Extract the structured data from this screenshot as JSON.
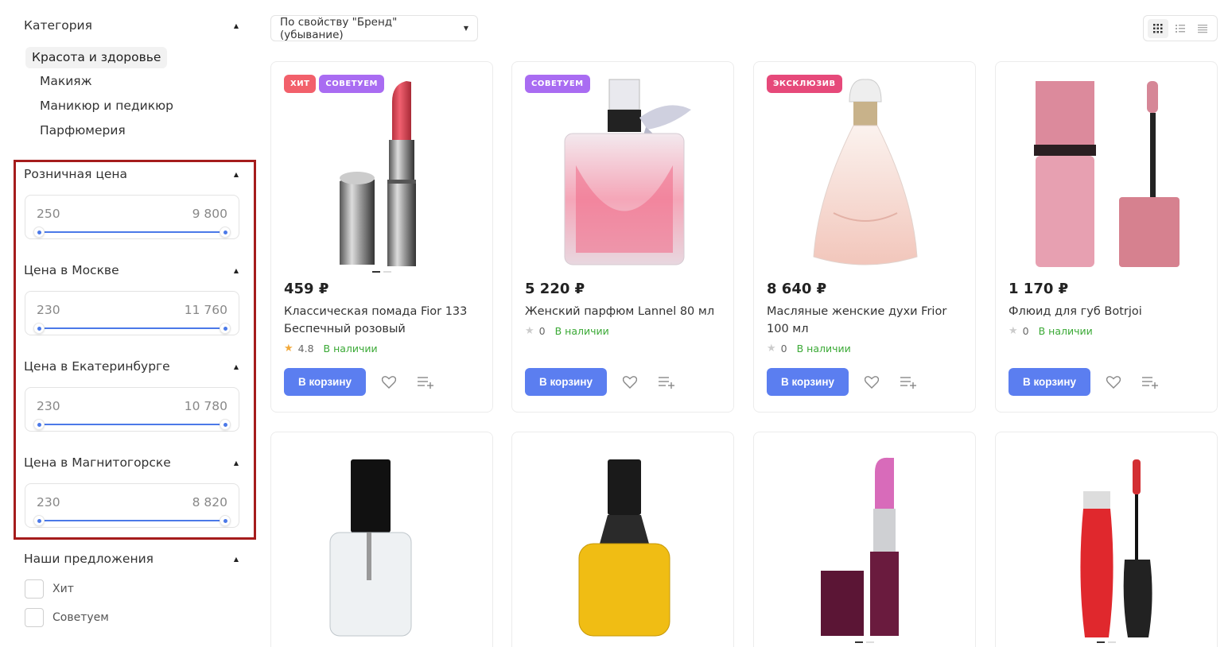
{
  "filters": {
    "category": {
      "title": "Категория",
      "active": "Красота и здоровье",
      "subs": [
        "Макияж",
        "Маникюр и педикюр",
        "Парфюмерия"
      ]
    },
    "ranges": [
      {
        "title": "Розничная цена",
        "min": "250",
        "max": "9 800"
      },
      {
        "title": "Цена в Москве",
        "min": "230",
        "max": "11 760"
      },
      {
        "title": "Цена в Екатеринбурге",
        "min": "230",
        "max": "10 780"
      },
      {
        "title": "Цена в Магнитогорске",
        "min": "230",
        "max": "8 820"
      }
    ],
    "offers": {
      "title": "Наши предложения",
      "options": [
        "Хит",
        "Советуем"
      ]
    }
  },
  "toolbar": {
    "sort_label": "По свойству \"Бренд\" (убывание)"
  },
  "products": [
    {
      "badges": [
        "ХИТ",
        "СОВЕТУЕМ"
      ],
      "price": "459 ₽",
      "title": "Классическая помада Fior 133 Беспечный розовый",
      "rating": "4.8",
      "stock": "В наличии",
      "cart": "В корзину"
    },
    {
      "badges": [
        "СОВЕТУЕМ"
      ],
      "price": "5 220 ₽",
      "title": "Женский парфюм Lannel 80 мл",
      "rating": "0",
      "stock": "В наличии",
      "cart": "В корзину"
    },
    {
      "badges": [
        "ЭКСКЛЮЗИВ"
      ],
      "price": "8 640 ₽",
      "title": "Масляные женские духи Frior 100 мл",
      "rating": "0",
      "stock": "В наличии",
      "cart": "В корзину"
    },
    {
      "badges": [],
      "price": "1 170 ₽",
      "title": "Флюид для губ Botrjoi",
      "rating": "0",
      "stock": "В наличии",
      "cart": "В корзину"
    }
  ],
  "colors": {
    "accent": "#5b7ef0",
    "badge_hit": "#f2606b",
    "badge_recommend": "#a96cf2",
    "badge_exclusive": "#e6497a",
    "in_stock": "#3aa935",
    "highlight_border": "#a51c1c"
  }
}
